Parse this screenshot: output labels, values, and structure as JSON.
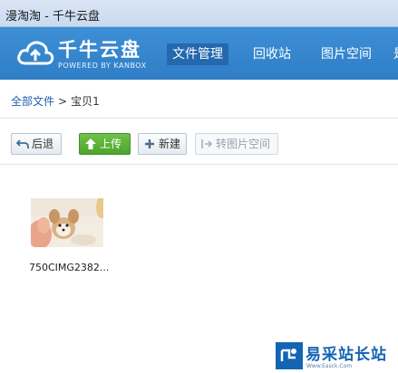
{
  "window": {
    "title": "漫淘淘 - 千牛云盘"
  },
  "header": {
    "logo_name": "千牛云盘",
    "logo_sub": "POWERED BY KANBOX",
    "tabs": [
      {
        "label": "文件管理",
        "active": true
      },
      {
        "label": "回收站",
        "active": false
      },
      {
        "label": "图片空间",
        "active": false
      },
      {
        "label": "是",
        "active": false
      }
    ]
  },
  "breadcrumb": {
    "root": "全部文件",
    "separator": ">",
    "current": "宝贝1"
  },
  "toolbar": {
    "back_label": "后退",
    "upload_label": "上传",
    "new_label": "新建",
    "move_label": "转图片空间"
  },
  "files": [
    {
      "name": "750CIMG2382..."
    }
  ],
  "watermark": {
    "title": "易采站长站",
    "url": "Www.Easck.Com"
  },
  "colors": {
    "header": "#3386cf",
    "active_tab": "#2468ad",
    "upload": "#5bb236",
    "link": "#1f5fab"
  }
}
